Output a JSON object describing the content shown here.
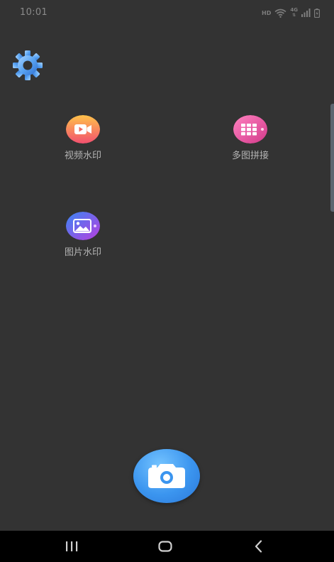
{
  "status_bar": {
    "time": "10:01",
    "hd_label": "HD",
    "network_label": "4G",
    "icons": [
      "hd-icon",
      "wifi-icon",
      "signal-icon",
      "battery-charging-icon"
    ]
  },
  "settings": {
    "icon": "gear-icon"
  },
  "features": [
    {
      "label": "视频水印",
      "icon": "video-camera-icon",
      "colors": [
        "#ffb84d",
        "#f0566e"
      ]
    },
    {
      "label": "多图拼接",
      "icon": "grid-icon",
      "colors": [
        "#ff72b3",
        "#d43d8a"
      ]
    },
    {
      "label": "图片水印",
      "icon": "image-icon",
      "colors": [
        "#3f7cf5",
        "#b43fe0"
      ]
    }
  ],
  "camera_button": {
    "icon": "camera-icon",
    "color": "#3b95ef"
  },
  "nav_bar": {
    "items": [
      "recent-apps-icon",
      "home-icon",
      "back-icon"
    ]
  }
}
